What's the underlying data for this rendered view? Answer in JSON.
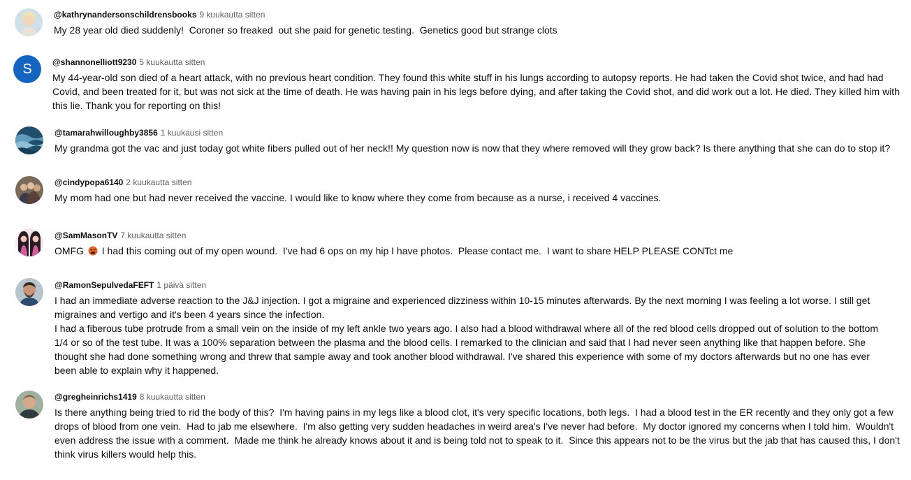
{
  "comments": [
    {
      "handle": "@kathrynandersonschildrensbooks",
      "time": "9 kuukautta sitten",
      "text": "My 28 year old died suddenly!  Coroner so freaked  out she paid for genetic testing.  Genetics good but strange clots"
    },
    {
      "handle": "@shannonelliott9230",
      "time": "5 kuukautta sitten",
      "avatar_letter": "S",
      "avatar_color": "#1565c0",
      "text": "My 44-year-old son died of a heart attack, with no previous heart condition. They found this white stuff in his lungs according to autopsy reports. He had taken the Covid shot twice, and had had Covid, and been treated for it, but was not sick at the time of death. He was having pain in his legs before dying, and after taking the Covid shot, and did work out a lot. He died. They killed him with this lie. Thank you for reporting on this!"
    },
    {
      "handle": "@tamarahwilloughby3856",
      "time": "1 kuukausi sitten",
      "text": "My grandma got the vac and just today got white fibers pulled out of her neck!! My question now is now that they where removed will they grow back? Is there anything that she can do to stop it?"
    },
    {
      "handle": "@cindypopa6140",
      "time": "2 kuukautta sitten",
      "text": "My mom had one but had never received the vaccine. I would like to know where they come from because as a nurse, i received 4 vaccines."
    },
    {
      "handle": "@SamMasonTV",
      "time": "7 kuukautta sitten",
      "text_before": "OMFG",
      "emoji": "angry-face-emoji",
      "text_after": " I had this coming out of my open wound.  I've had 6 ops on my hip I have photos.  Please contact me.  I want to share HELP PLEASE CONTct me"
    },
    {
      "handle": "@RamonSepulvedaFEFT",
      "time": "1 päivä sitten",
      "text": "I had an immediate adverse reaction to the J&J injection. I got a migraine and experienced dizziness within 10-15 minutes afterwards. By the next morning I was feeling a lot worse. I still get migraines and vertigo and it's been 4 years since the infection.\nI had a fiberous tube protrude from a small vein on the inside of my left ankle two years ago. I also had a blood withdrawal where all of the red blood cells dropped out of solution to the bottom 1/4 or so of the test tube. It was a 100% separation between the plasma and the blood cells. I remarked to the clinician and said that I had never seen anything like that happen before. She thought she had done something wrong and threw that sample away and took another blood withdrawal. I've shared this experience with some of my doctors afterwards but no one has ever been able to explain why it happened."
    },
    {
      "handle": "@gregheinrichs1419",
      "time": "8 kuukautta sitten",
      "text": "Is there anything being tried to rid the body of this?  I'm having pains in my legs like a blood clot, it's very specific locations, both legs.  I had a blood test in the ER recently and they only got a few drops of blood from one vein.  Had to jab me elsewhere.  I'm also getting very sudden headaches in weird area's I've never had before.  My doctor ignored my concerns when I told him.  Wouldn't even address the issue with a comment.  Made me think he already knows about it and is being told not to speak to it.  Since this appears not to be the virus but the jab that has caused this, I don't think virus killers would help this."
    }
  ]
}
